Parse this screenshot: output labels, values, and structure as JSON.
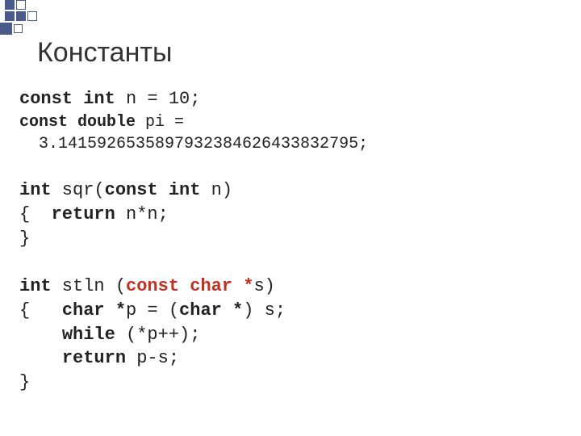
{
  "title": "Константы",
  "code": {
    "l1_kw": "const int",
    "l1_rest": " n = 10;",
    "l2_kw": "const double",
    "l2_a": " pi =",
    "l2_b": "  3.1415926535897932384626433832795;",
    "l4_kw1": "int",
    "l4_sp1": " sqr(",
    "l4_kw2": "const int",
    "l4_sp2": " n)",
    "l5_a": "{  ",
    "l5_kw": "return",
    "l5_b": " n*n;",
    "l6": "}",
    "l8_kw1": "int",
    "l8_a": " stln (",
    "l8_red": "const char *",
    "l8_b": "s)",
    "l9_a": "{   ",
    "l9_kw1": "char *",
    "l9_b": "p = (",
    "l9_kw2": "char *",
    "l9_c": ") s;",
    "l10_a": "    ",
    "l10_kw": "while",
    "l10_b": " (*p++);",
    "l11_a": "    ",
    "l11_kw": "return",
    "l11_b": " p-s;",
    "l12": "}"
  }
}
